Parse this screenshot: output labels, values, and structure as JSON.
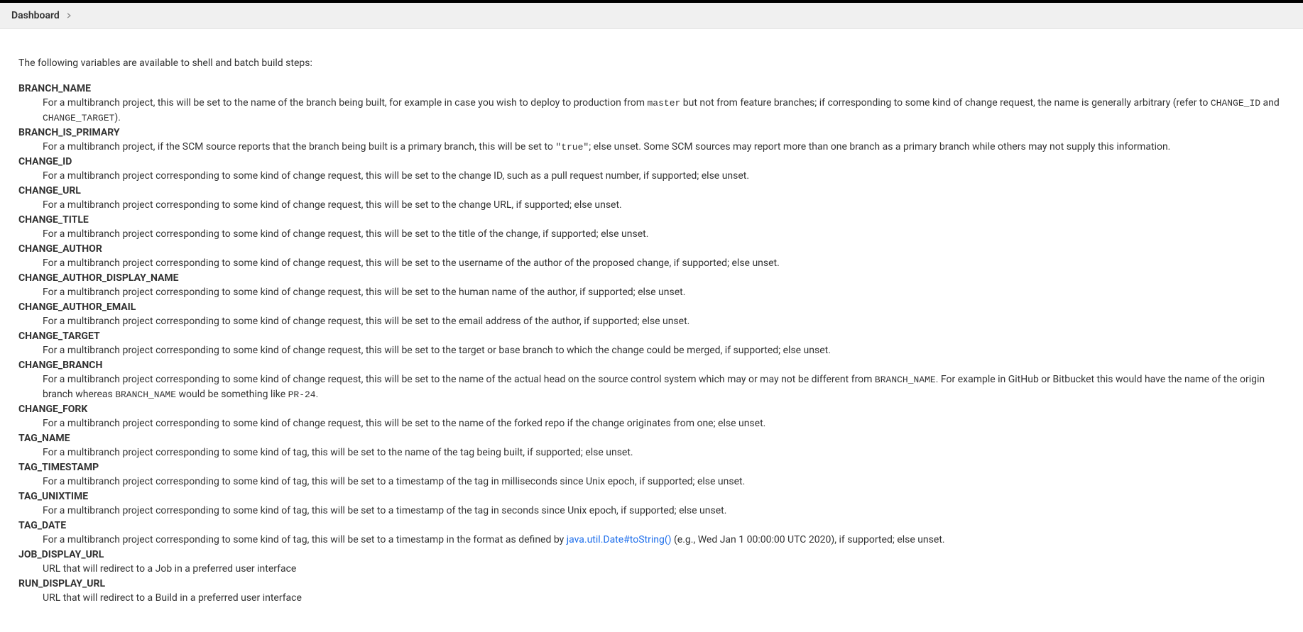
{
  "breadcrumb": {
    "items": [
      {
        "label": "Dashboard"
      }
    ]
  },
  "intro": "The following variables are available to shell and batch build steps:",
  "link": {
    "text": "java.util.Date#toString()"
  },
  "vars": [
    {
      "name": "BRANCH_NAME",
      "segments": [
        {
          "type": "text",
          "value": "For a multibranch project, this will be set to the name of the branch being built, for example in case you wish to deploy to production from "
        },
        {
          "type": "code",
          "value": "master"
        },
        {
          "type": "text",
          "value": " but not from feature branches; if corresponding to some kind of change request, the name is generally arbitrary (refer to "
        },
        {
          "type": "code",
          "value": "CHANGE_ID"
        },
        {
          "type": "text",
          "value": " and "
        },
        {
          "type": "code",
          "value": "CHANGE_TARGET"
        },
        {
          "type": "text",
          "value": ")."
        }
      ]
    },
    {
      "name": "BRANCH_IS_PRIMARY",
      "segments": [
        {
          "type": "text",
          "value": "For a multibranch project, if the SCM source reports that the branch being built is a primary branch, this will be set to "
        },
        {
          "type": "code",
          "value": "\"true\""
        },
        {
          "type": "text",
          "value": "; else unset. Some SCM sources may report more than one branch as a primary branch while others may not supply this information."
        }
      ]
    },
    {
      "name": "CHANGE_ID",
      "segments": [
        {
          "type": "text",
          "value": "For a multibranch project corresponding to some kind of change request, this will be set to the change ID, such as a pull request number, if supported; else unset."
        }
      ]
    },
    {
      "name": "CHANGE_URL",
      "segments": [
        {
          "type": "text",
          "value": "For a multibranch project corresponding to some kind of change request, this will be set to the change URL, if supported; else unset."
        }
      ]
    },
    {
      "name": "CHANGE_TITLE",
      "segments": [
        {
          "type": "text",
          "value": "For a multibranch project corresponding to some kind of change request, this will be set to the title of the change, if supported; else unset."
        }
      ]
    },
    {
      "name": "CHANGE_AUTHOR",
      "segments": [
        {
          "type": "text",
          "value": "For a multibranch project corresponding to some kind of change request, this will be set to the username of the author of the proposed change, if supported; else unset."
        }
      ]
    },
    {
      "name": "CHANGE_AUTHOR_DISPLAY_NAME",
      "segments": [
        {
          "type": "text",
          "value": "For a multibranch project corresponding to some kind of change request, this will be set to the human name of the author, if supported; else unset."
        }
      ]
    },
    {
      "name": "CHANGE_AUTHOR_EMAIL",
      "segments": [
        {
          "type": "text",
          "value": "For a multibranch project corresponding to some kind of change request, this will be set to the email address of the author, if supported; else unset."
        }
      ]
    },
    {
      "name": "CHANGE_TARGET",
      "segments": [
        {
          "type": "text",
          "value": "For a multibranch project corresponding to some kind of change request, this will be set to the target or base branch to which the change could be merged, if supported; else unset."
        }
      ]
    },
    {
      "name": "CHANGE_BRANCH",
      "segments": [
        {
          "type": "text",
          "value": "For a multibranch project corresponding to some kind of change request, this will be set to the name of the actual head on the source control system which may or may not be different from "
        },
        {
          "type": "code",
          "value": "BRANCH_NAME"
        },
        {
          "type": "text",
          "value": ". For example in GitHub or Bitbucket this would have the name of the origin branch whereas "
        },
        {
          "type": "code",
          "value": "BRANCH_NAME"
        },
        {
          "type": "text",
          "value": " would be something like "
        },
        {
          "type": "code",
          "value": "PR-24"
        },
        {
          "type": "text",
          "value": "."
        }
      ]
    },
    {
      "name": "CHANGE_FORK",
      "segments": [
        {
          "type": "text",
          "value": "For a multibranch project corresponding to some kind of change request, this will be set to the name of the forked repo if the change originates from one; else unset."
        }
      ]
    },
    {
      "name": "TAG_NAME",
      "segments": [
        {
          "type": "text",
          "value": "For a multibranch project corresponding to some kind of tag, this will be set to the name of the tag being built, if supported; else unset."
        }
      ]
    },
    {
      "name": "TAG_TIMESTAMP",
      "segments": [
        {
          "type": "text",
          "value": "For a multibranch project corresponding to some kind of tag, this will be set to a timestamp of the tag in milliseconds since Unix epoch, if supported; else unset."
        }
      ]
    },
    {
      "name": "TAG_UNIXTIME",
      "segments": [
        {
          "type": "text",
          "value": "For a multibranch project corresponding to some kind of tag, this will be set to a timestamp of the tag in seconds since Unix epoch, if supported; else unset."
        }
      ]
    },
    {
      "name": "TAG_DATE",
      "segments": [
        {
          "type": "text",
          "value": "For a multibranch project corresponding to some kind of tag, this will be set to a timestamp in the format as defined by "
        },
        {
          "type": "link",
          "value": "java.util.Date#toString()"
        },
        {
          "type": "text",
          "value": " (e.g., Wed Jan 1 00:00:00 UTC 2020), if supported; else unset."
        }
      ]
    },
    {
      "name": "JOB_DISPLAY_URL",
      "segments": [
        {
          "type": "text",
          "value": "URL that will redirect to a Job in a preferred user interface"
        }
      ]
    },
    {
      "name": "RUN_DISPLAY_URL",
      "segments": [
        {
          "type": "text",
          "value": "URL that will redirect to a Build in a preferred user interface"
        }
      ]
    }
  ]
}
